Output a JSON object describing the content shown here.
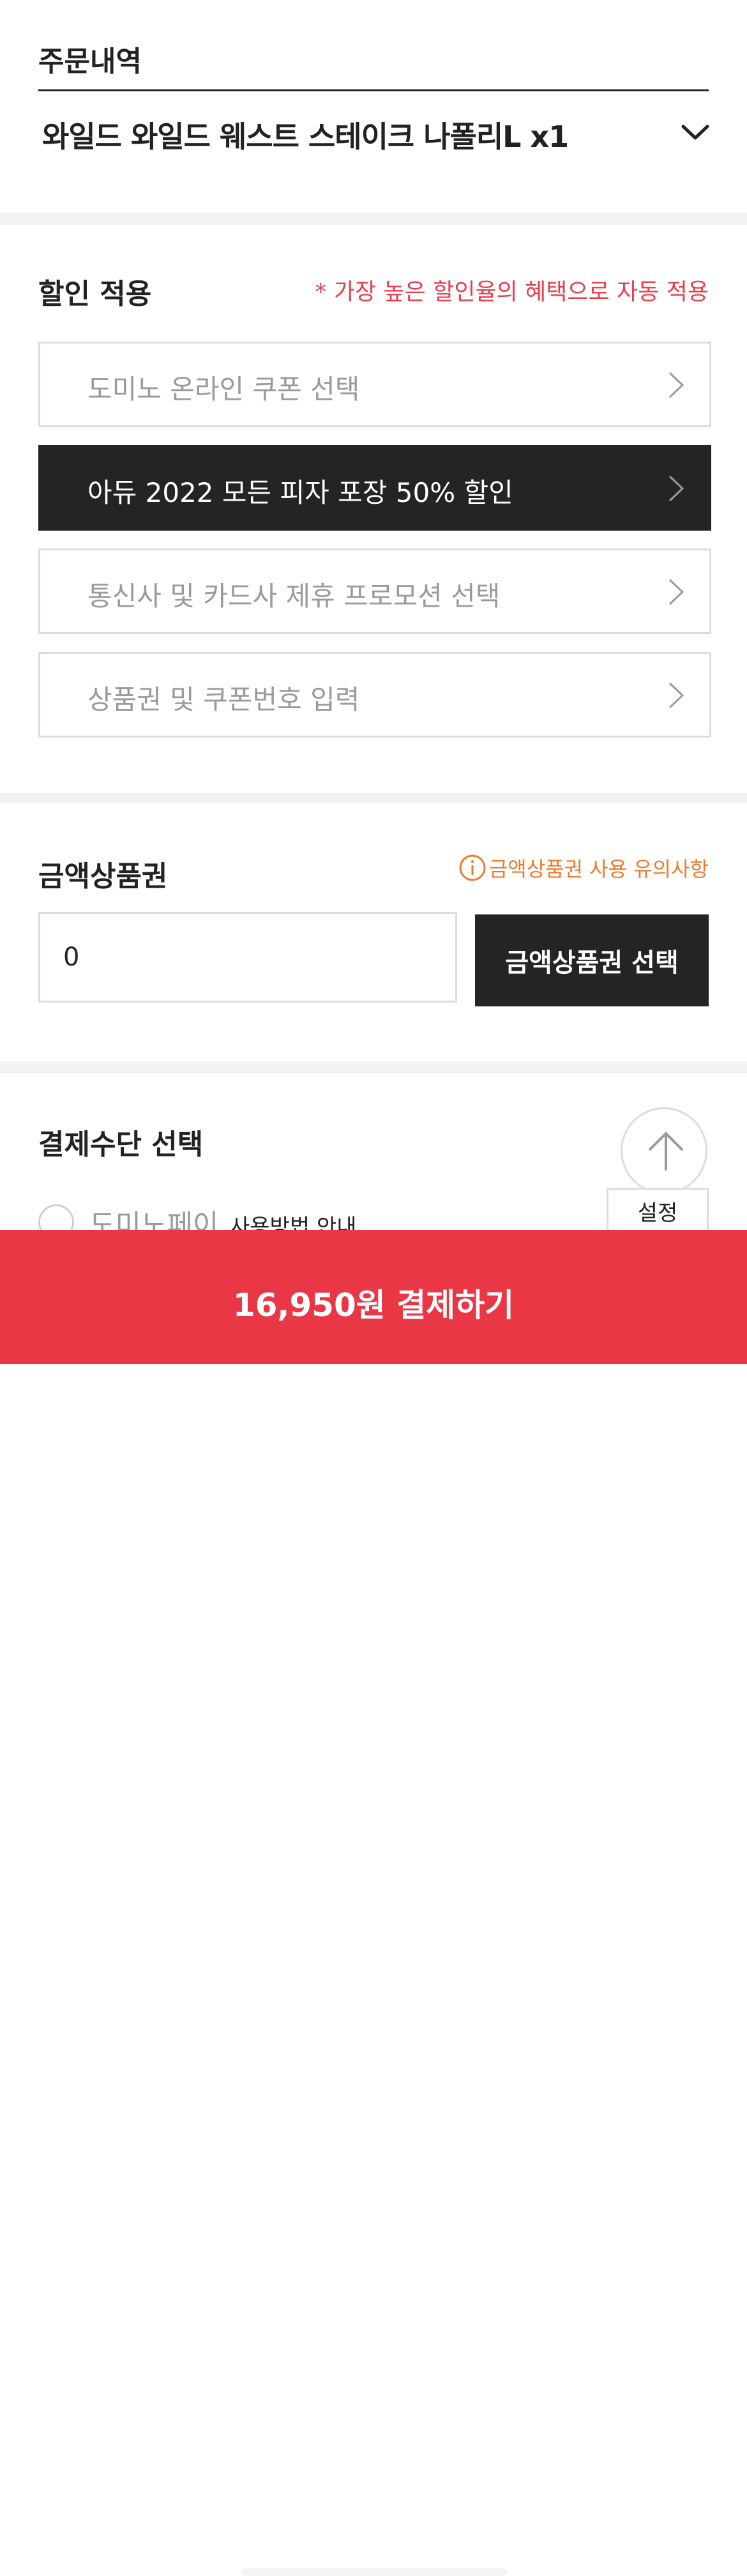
{
  "order": {
    "title": "주문내역",
    "item": "와일드 와일드 웨스트 스테이크 나폴리L x1"
  },
  "discount": {
    "title": "할인 적용",
    "note": "* 가장 높은 할인율의 혜택으로 자동 적용",
    "options": [
      {
        "label": "도미노 온라인 쿠폰 선택",
        "selected": false
      },
      {
        "label": "아듀 2022 모든 피자 포장 50% 할인",
        "selected": true
      },
      {
        "label": "통신사 및 카드사 제휴 프로모션 선택",
        "selected": false
      },
      {
        "label": "상품권 및 쿠폰번호 입력",
        "selected": false
      }
    ]
  },
  "gift_card": {
    "title": "금액상품권",
    "warning": "금액상품권 사용 유의사항",
    "amount_value": "0",
    "select_button": "금액상품권 선택"
  },
  "payment_method": {
    "title": "결제수단 선택",
    "option_label": "도미노페이",
    "guide_label": "사용방법 안내",
    "setting_button": "설정"
  },
  "pay_button": "16,950원 결제하기",
  "colors": {
    "accent_red": "#e93745",
    "note_red": "#e8404f",
    "warning_orange": "#f07a2a",
    "dark": "#242424"
  }
}
